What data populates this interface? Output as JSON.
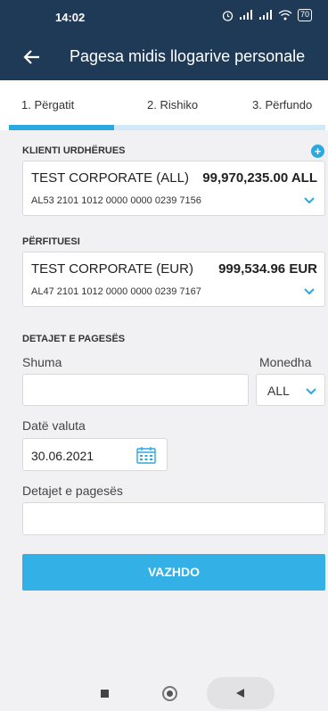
{
  "status_bar": {
    "time": "14:02",
    "battery": "70"
  },
  "app_bar": {
    "title": "Pagesa midis llogarive personale"
  },
  "steps": [
    {
      "label": "1. Përgatit"
    },
    {
      "label": "2. Rishiko"
    },
    {
      "label": "3. Përfundo"
    }
  ],
  "step_progress": {
    "active_step": 1,
    "total_steps": 3
  },
  "payer": {
    "section_label": "KLIENTI URDHËRUES",
    "name": "TEST CORPORATE (ALL)",
    "amount": "99,970,235.00 ALL",
    "iban": "AL53 2101 1012 0000 0000 0239 7156"
  },
  "beneficiary": {
    "section_label": "PËRFITUESI",
    "name": "TEST CORPORATE (EUR)",
    "amount": "999,534.96 EUR",
    "iban": "AL47 2101 1012 0000 0000 0239 7167"
  },
  "details": {
    "section_label": "DETAJET E PAGESËS",
    "amount_label": "Shuma",
    "amount_value": "",
    "currency_label": "Monedha",
    "currency_value": "ALL",
    "value_date_label": "Datë valuta",
    "value_date": "30.06.2021",
    "payment_details_label": "Detajet e pagesës",
    "payment_details_value": ""
  },
  "actions": {
    "continue_label": "VAZHDO"
  },
  "colors": {
    "header": "#1f3a57",
    "accent": "#2aa9e0",
    "button": "#33b0e6",
    "background": "#f1f1f3"
  }
}
